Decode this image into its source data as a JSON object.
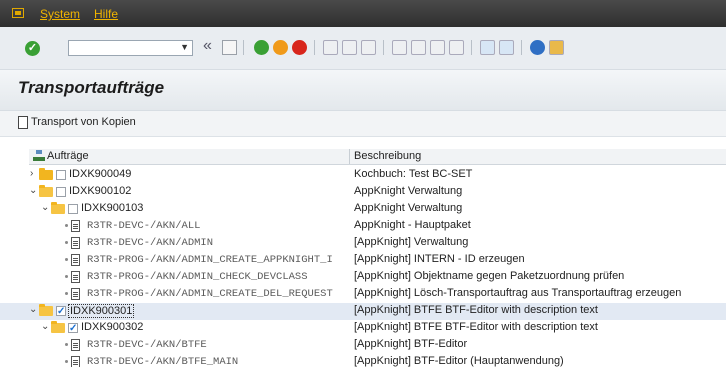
{
  "menubar": {
    "items": [
      "System",
      "Hilfe"
    ]
  },
  "toolbar": {
    "command_value": "",
    "back_glyph": "«"
  },
  "title": "Transportaufträge",
  "appbar": {
    "transport_copies": "Transport von Kopien"
  },
  "tree": {
    "columns": [
      "Aufträge",
      "Beschreibung"
    ],
    "rows": [
      {
        "id": "IDXK900049",
        "desc": "Kochbuch: Test BC-SET"
      },
      {
        "id": "IDXK900102",
        "desc": "AppKnight Verwaltung"
      },
      {
        "id": "IDXK900103",
        "desc": "AppKnight Verwaltung"
      },
      {
        "id": "R3TR-DEVC-/AKN/ALL",
        "desc": "AppKnight - Hauptpaket"
      },
      {
        "id": "R3TR-DEVC-/AKN/ADMIN",
        "desc": "[AppKnight] Verwaltung"
      },
      {
        "id": "R3TR-PROG-/AKN/ADMIN_CREATE_APPKNIGHT_I",
        "desc": "[AppKnight] INTERN - ID erzeugen"
      },
      {
        "id": "R3TR-PROG-/AKN/ADMIN_CHECK_DEVCLASS",
        "desc": "[AppKnight] Objektname gegen Paketzuordnung prüfen"
      },
      {
        "id": "R3TR-PROG-/AKN/ADMIN_CREATE_DEL_REQUEST",
        "desc": "[AppKnight] Lösch-Transportauftrag aus Transportauftrag erzeugen"
      },
      {
        "id": "IDXK900301",
        "desc": "[AppKnight] BTFE BTF-Editor with description text"
      },
      {
        "id": "IDXK900302",
        "desc": "[AppKnight] BTFE BTF-Editor with description text"
      },
      {
        "id": "R3TR-DEVC-/AKN/BTFE",
        "desc": "[AppKnight] BTF-Editor"
      },
      {
        "id": "R3TR-DEVC-/AKN/BTFE_MAIN",
        "desc": "[AppKnight] BTF-Editor (Hauptanwendung)"
      }
    ]
  }
}
